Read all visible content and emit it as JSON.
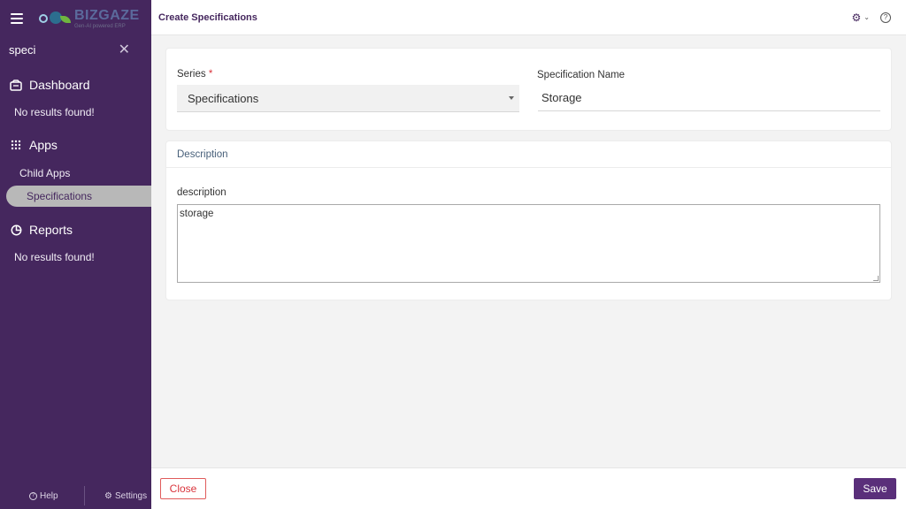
{
  "app": {
    "brand": "BIZGAZE",
    "brand_tagline": "Gen-AI powered ERP"
  },
  "sidebar": {
    "search_value": "speci",
    "sections": [
      {
        "label": "Dashboard",
        "icon": "dashboard-icon",
        "empty_text": "No results found!"
      },
      {
        "label": "Apps",
        "icon": "grid-icon"
      },
      {
        "label": "Reports",
        "icon": "pie-chart-icon",
        "empty_text": "No results found!"
      }
    ],
    "apps_items": [
      {
        "label": "Child Apps",
        "active": false
      },
      {
        "label": "Specifications",
        "active": true
      }
    ],
    "footer": {
      "help_label": "Help",
      "settings_label": "Settings"
    }
  },
  "header": {
    "title": "Create Specifications"
  },
  "form": {
    "series_label": "Series",
    "series_required_mark": "*",
    "series_value": "Specifications",
    "spec_name_label": "Specification Name",
    "spec_name_value": "Storage",
    "description_section_title": "Description",
    "description_label": "description",
    "description_value": "storage"
  },
  "actions": {
    "close_label": "Close",
    "save_label": "Save"
  },
  "colors": {
    "sidebar_bg": "#45275e",
    "accent": "#5a2f7a",
    "danger": "#d9343c"
  }
}
